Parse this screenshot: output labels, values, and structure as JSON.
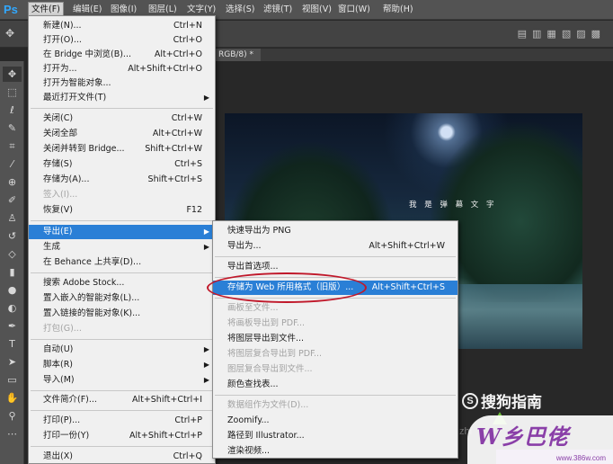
{
  "app": {
    "logo": "Ps"
  },
  "menubar": [
    "文件(F)",
    "编辑(E)",
    "图像(I)",
    "图层(L)",
    "文字(Y)",
    "选择(S)",
    "滤镜(T)",
    "视图(V)",
    "窗口(W)",
    "帮助(H)"
  ],
  "doc_tab": "RGB/8) *",
  "photo_caption": "我 是 弹 幕 文 字",
  "file_menu": [
    {
      "label": "新建(N)...",
      "shortcut": "Ctrl+N"
    },
    {
      "label": "打开(O)...",
      "shortcut": "Ctrl+O"
    },
    {
      "label": "在 Bridge 中浏览(B)...",
      "shortcut": "Alt+Ctrl+O"
    },
    {
      "label": "打开为...",
      "shortcut": "Alt+Shift+Ctrl+O"
    },
    {
      "label": "打开为智能对象...",
      "shortcut": ""
    },
    {
      "label": "最近打开文件(T)",
      "shortcut": ""
    },
    {
      "label": "关闭(C)",
      "shortcut": "Ctrl+W"
    },
    {
      "label": "关闭全部",
      "shortcut": "Alt+Ctrl+W"
    },
    {
      "label": "关闭并转到 Bridge...",
      "shortcut": "Shift+Ctrl+W"
    },
    {
      "label": "存储(S)",
      "shortcut": "Ctrl+S"
    },
    {
      "label": "存储为(A)...",
      "shortcut": "Shift+Ctrl+S"
    },
    {
      "label": "签入(I)...",
      "shortcut": ""
    },
    {
      "label": "恢复(V)",
      "shortcut": "F12"
    },
    {
      "label": "导出(E)",
      "shortcut": ""
    },
    {
      "label": "生成",
      "shortcut": ""
    },
    {
      "label": "在 Behance 上共享(D)...",
      "shortcut": ""
    },
    {
      "label": "搜索 Adobe Stock...",
      "shortcut": ""
    },
    {
      "label": "置入嵌入的智能对象(L)...",
      "shortcut": ""
    },
    {
      "label": "置入链接的智能对象(K)...",
      "shortcut": ""
    },
    {
      "label": "打包(G)...",
      "shortcut": ""
    },
    {
      "label": "自动(U)",
      "shortcut": ""
    },
    {
      "label": "脚本(R)",
      "shortcut": ""
    },
    {
      "label": "导入(M)",
      "shortcut": ""
    },
    {
      "label": "文件简介(F)...",
      "shortcut": "Alt+Shift+Ctrl+I"
    },
    {
      "label": "打印(P)...",
      "shortcut": "Ctrl+P"
    },
    {
      "label": "打印一份(Y)",
      "shortcut": "Alt+Shift+Ctrl+P"
    },
    {
      "label": "退出(X)",
      "shortcut": "Ctrl+Q"
    }
  ],
  "export_menu": [
    {
      "label": "快速导出为 PNG",
      "shortcut": ""
    },
    {
      "label": "导出为...",
      "shortcut": "Alt+Shift+Ctrl+W"
    },
    {
      "label": "导出首选项...",
      "shortcut": ""
    },
    {
      "label": "存储为 Web 所用格式（旧版）...",
      "shortcut": "Alt+Shift+Ctrl+S"
    },
    {
      "label": "画板至文件...",
      "shortcut": ""
    },
    {
      "label": "将画板导出到 PDF...",
      "shortcut": ""
    },
    {
      "label": "将图层导出到文件...",
      "shortcut": ""
    },
    {
      "label": "将图层复合导出到 PDF...",
      "shortcut": ""
    },
    {
      "label": "图层复合导出到文件...",
      "shortcut": ""
    },
    {
      "label": "颜色查找表...",
      "shortcut": ""
    },
    {
      "label": "数据组作为文件(D)...",
      "shortcut": ""
    },
    {
      "label": "Zoomify...",
      "shortcut": ""
    },
    {
      "label": "路径到 Illustrator...",
      "shortcut": ""
    },
    {
      "label": "渲染视频...",
      "shortcut": ""
    }
  ],
  "watermarks": {
    "sogou": "搜狗指南",
    "sogou_mark": "S",
    "zhi": "zhi",
    "site_logo": "W乡巴佬",
    "site_url": "www.386w.com"
  },
  "colors": {
    "highlight": "#2a7fd6",
    "annotation_oval": "#c0182a"
  }
}
